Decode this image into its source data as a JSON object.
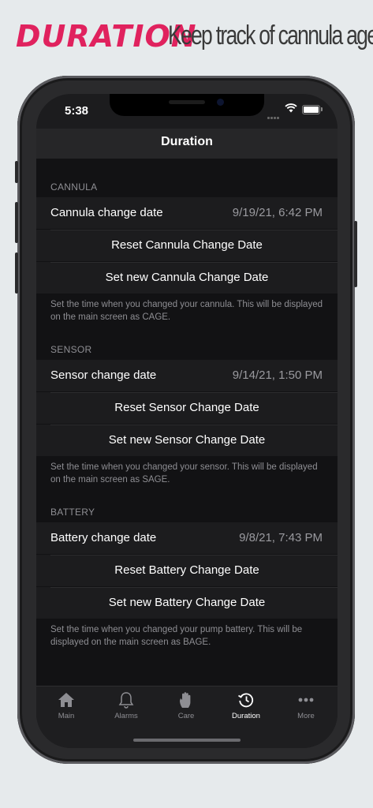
{
  "promo": {
    "title": "DURATION",
    "subtitle": "Keep track of cannula age"
  },
  "status": {
    "time": "5:38"
  },
  "nav": {
    "title": "Duration"
  },
  "sections": [
    {
      "header": "CANNULA",
      "change_label": "Cannula change date",
      "change_value": "9/19/21, 6:42 PM",
      "reset_label": "Reset Cannula Change Date",
      "set_label": "Set new Cannula Change Date",
      "note": "Set the time when you changed your cannula. This will be displayed on the main screen as CAGE."
    },
    {
      "header": "SENSOR",
      "change_label": "Sensor change date",
      "change_value": "9/14/21, 1:50 PM",
      "reset_label": "Reset Sensor Change Date",
      "set_label": "Set new Sensor Change Date",
      "note": "Set the time when you changed your sensor. This will be displayed on the main screen as SAGE."
    },
    {
      "header": "BATTERY",
      "change_label": "Battery change date",
      "change_value": "9/8/21, 7:43 PM",
      "reset_label": "Reset Battery Change Date",
      "set_label": "Set new Battery Change Date",
      "note": "Set the time when you changed your pump battery. This will be displayed on the main screen as BAGE."
    }
  ],
  "tabs": [
    {
      "label": "Main",
      "icon": "house-icon",
      "active": false
    },
    {
      "label": "Alarms",
      "icon": "bell-icon",
      "active": false
    },
    {
      "label": "Care",
      "icon": "hand-icon",
      "active": false
    },
    {
      "label": "Duration",
      "icon": "clock-history-icon",
      "active": true
    },
    {
      "label": "More",
      "icon": "ellipsis-icon",
      "active": false
    }
  ],
  "colors": {
    "accent": "#e0225e",
    "background": "#121214",
    "cell": "#1c1c1e"
  }
}
